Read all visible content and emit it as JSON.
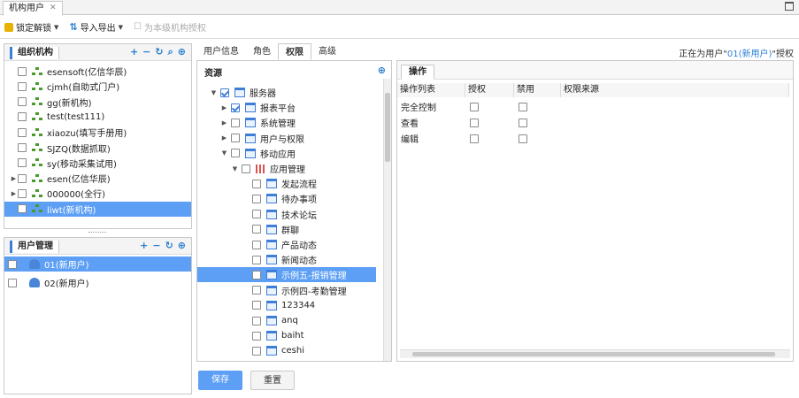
{
  "window": {
    "tab": "机构用户"
  },
  "toolbar": {
    "lock": "锁定解锁",
    "import": "导入导出",
    "authorize": "为本级机构授权"
  },
  "org_panel": {
    "title": "组织机构",
    "items": [
      {
        "label": "esensoft(亿信华辰)",
        "expand": false
      },
      {
        "label": "cjmh(自助式门户)",
        "expand": false
      },
      {
        "label": "gg(新机构)",
        "expand": false
      },
      {
        "label": "test(test111)",
        "expand": false
      },
      {
        "label": "xiaozu(填写手册用)",
        "expand": false
      },
      {
        "label": "SJZQ(数据抓取)",
        "expand": false
      },
      {
        "label": "sy(移动采集试用)",
        "expand": false
      },
      {
        "label": "esen(亿信华辰)",
        "expand": true
      },
      {
        "label": "000000(全行)",
        "expand": true
      },
      {
        "label": "liwt(新机构)",
        "expand": false,
        "selected": true
      }
    ]
  },
  "user_panel": {
    "title": "用户管理",
    "items": [
      {
        "label": "01(新用户)",
        "selected": true
      },
      {
        "label": "02(新用户)",
        "selected": false
      }
    ]
  },
  "tabs": [
    "用户信息",
    "角色",
    "权限",
    "高级"
  ],
  "active_tab": "权限",
  "status": {
    "prefix": "正在为用户\"",
    "user": "01(新用户)",
    "suffix": "\"授权"
  },
  "resource": {
    "title": "资源",
    "items": [
      {
        "label": "服务器",
        "level": 0,
        "exp": "open",
        "checked": true,
        "icon": "server"
      },
      {
        "label": "报表平台",
        "level": 1,
        "exp": "closed",
        "checked": true,
        "icon": "node"
      },
      {
        "label": "系统管理",
        "level": 1,
        "exp": "closed",
        "checked": false,
        "icon": "node"
      },
      {
        "label": "用户与权限",
        "level": 1,
        "exp": "closed",
        "checked": false,
        "icon": "users"
      },
      {
        "label": "移动应用",
        "level": 1,
        "exp": "open",
        "checked": false,
        "icon": "node"
      },
      {
        "label": "应用管理",
        "level": 2,
        "exp": "open",
        "checked": false,
        "icon": "grid"
      },
      {
        "label": "发起流程",
        "level": 3,
        "exp": "",
        "checked": false,
        "icon": "leaf"
      },
      {
        "label": "待办事项",
        "level": 3,
        "exp": "",
        "checked": false,
        "icon": "leaf"
      },
      {
        "label": "技术论坛",
        "level": 3,
        "exp": "",
        "checked": false,
        "icon": "leaf"
      },
      {
        "label": "群聊",
        "level": 3,
        "exp": "",
        "checked": false,
        "icon": "leaf"
      },
      {
        "label": "产品动态",
        "level": 3,
        "exp": "",
        "checked": false,
        "icon": "leaf"
      },
      {
        "label": "新闻动态",
        "level": 3,
        "exp": "",
        "checked": false,
        "icon": "leaf"
      },
      {
        "label": "示例五-报销管理",
        "level": 3,
        "exp": "",
        "checked": false,
        "icon": "leaf",
        "selected": true
      },
      {
        "label": "示例四-考勤管理",
        "level": 3,
        "exp": "",
        "checked": false,
        "icon": "leaf"
      },
      {
        "label": "123344",
        "level": 3,
        "exp": "",
        "checked": false,
        "icon": "leaf"
      },
      {
        "label": "anq",
        "level": 3,
        "exp": "",
        "checked": false,
        "icon": "leaf"
      },
      {
        "label": "baiht",
        "level": 3,
        "exp": "",
        "checked": false,
        "icon": "leaf"
      },
      {
        "label": "ceshi",
        "level": 3,
        "exp": "",
        "checked": false,
        "icon": "leaf"
      }
    ]
  },
  "ops": {
    "tab": "操作",
    "columns": [
      "操作列表",
      "授权",
      "禁用",
      "权限来源"
    ],
    "rows": [
      {
        "name": "完全控制",
        "grant": false,
        "deny": false,
        "source": ""
      },
      {
        "name": "查看",
        "grant": false,
        "deny": false,
        "source": ""
      },
      {
        "name": "编辑",
        "grant": false,
        "deny": false,
        "source": ""
      }
    ]
  },
  "buttons": {
    "save": "保存",
    "reset": "重置"
  }
}
